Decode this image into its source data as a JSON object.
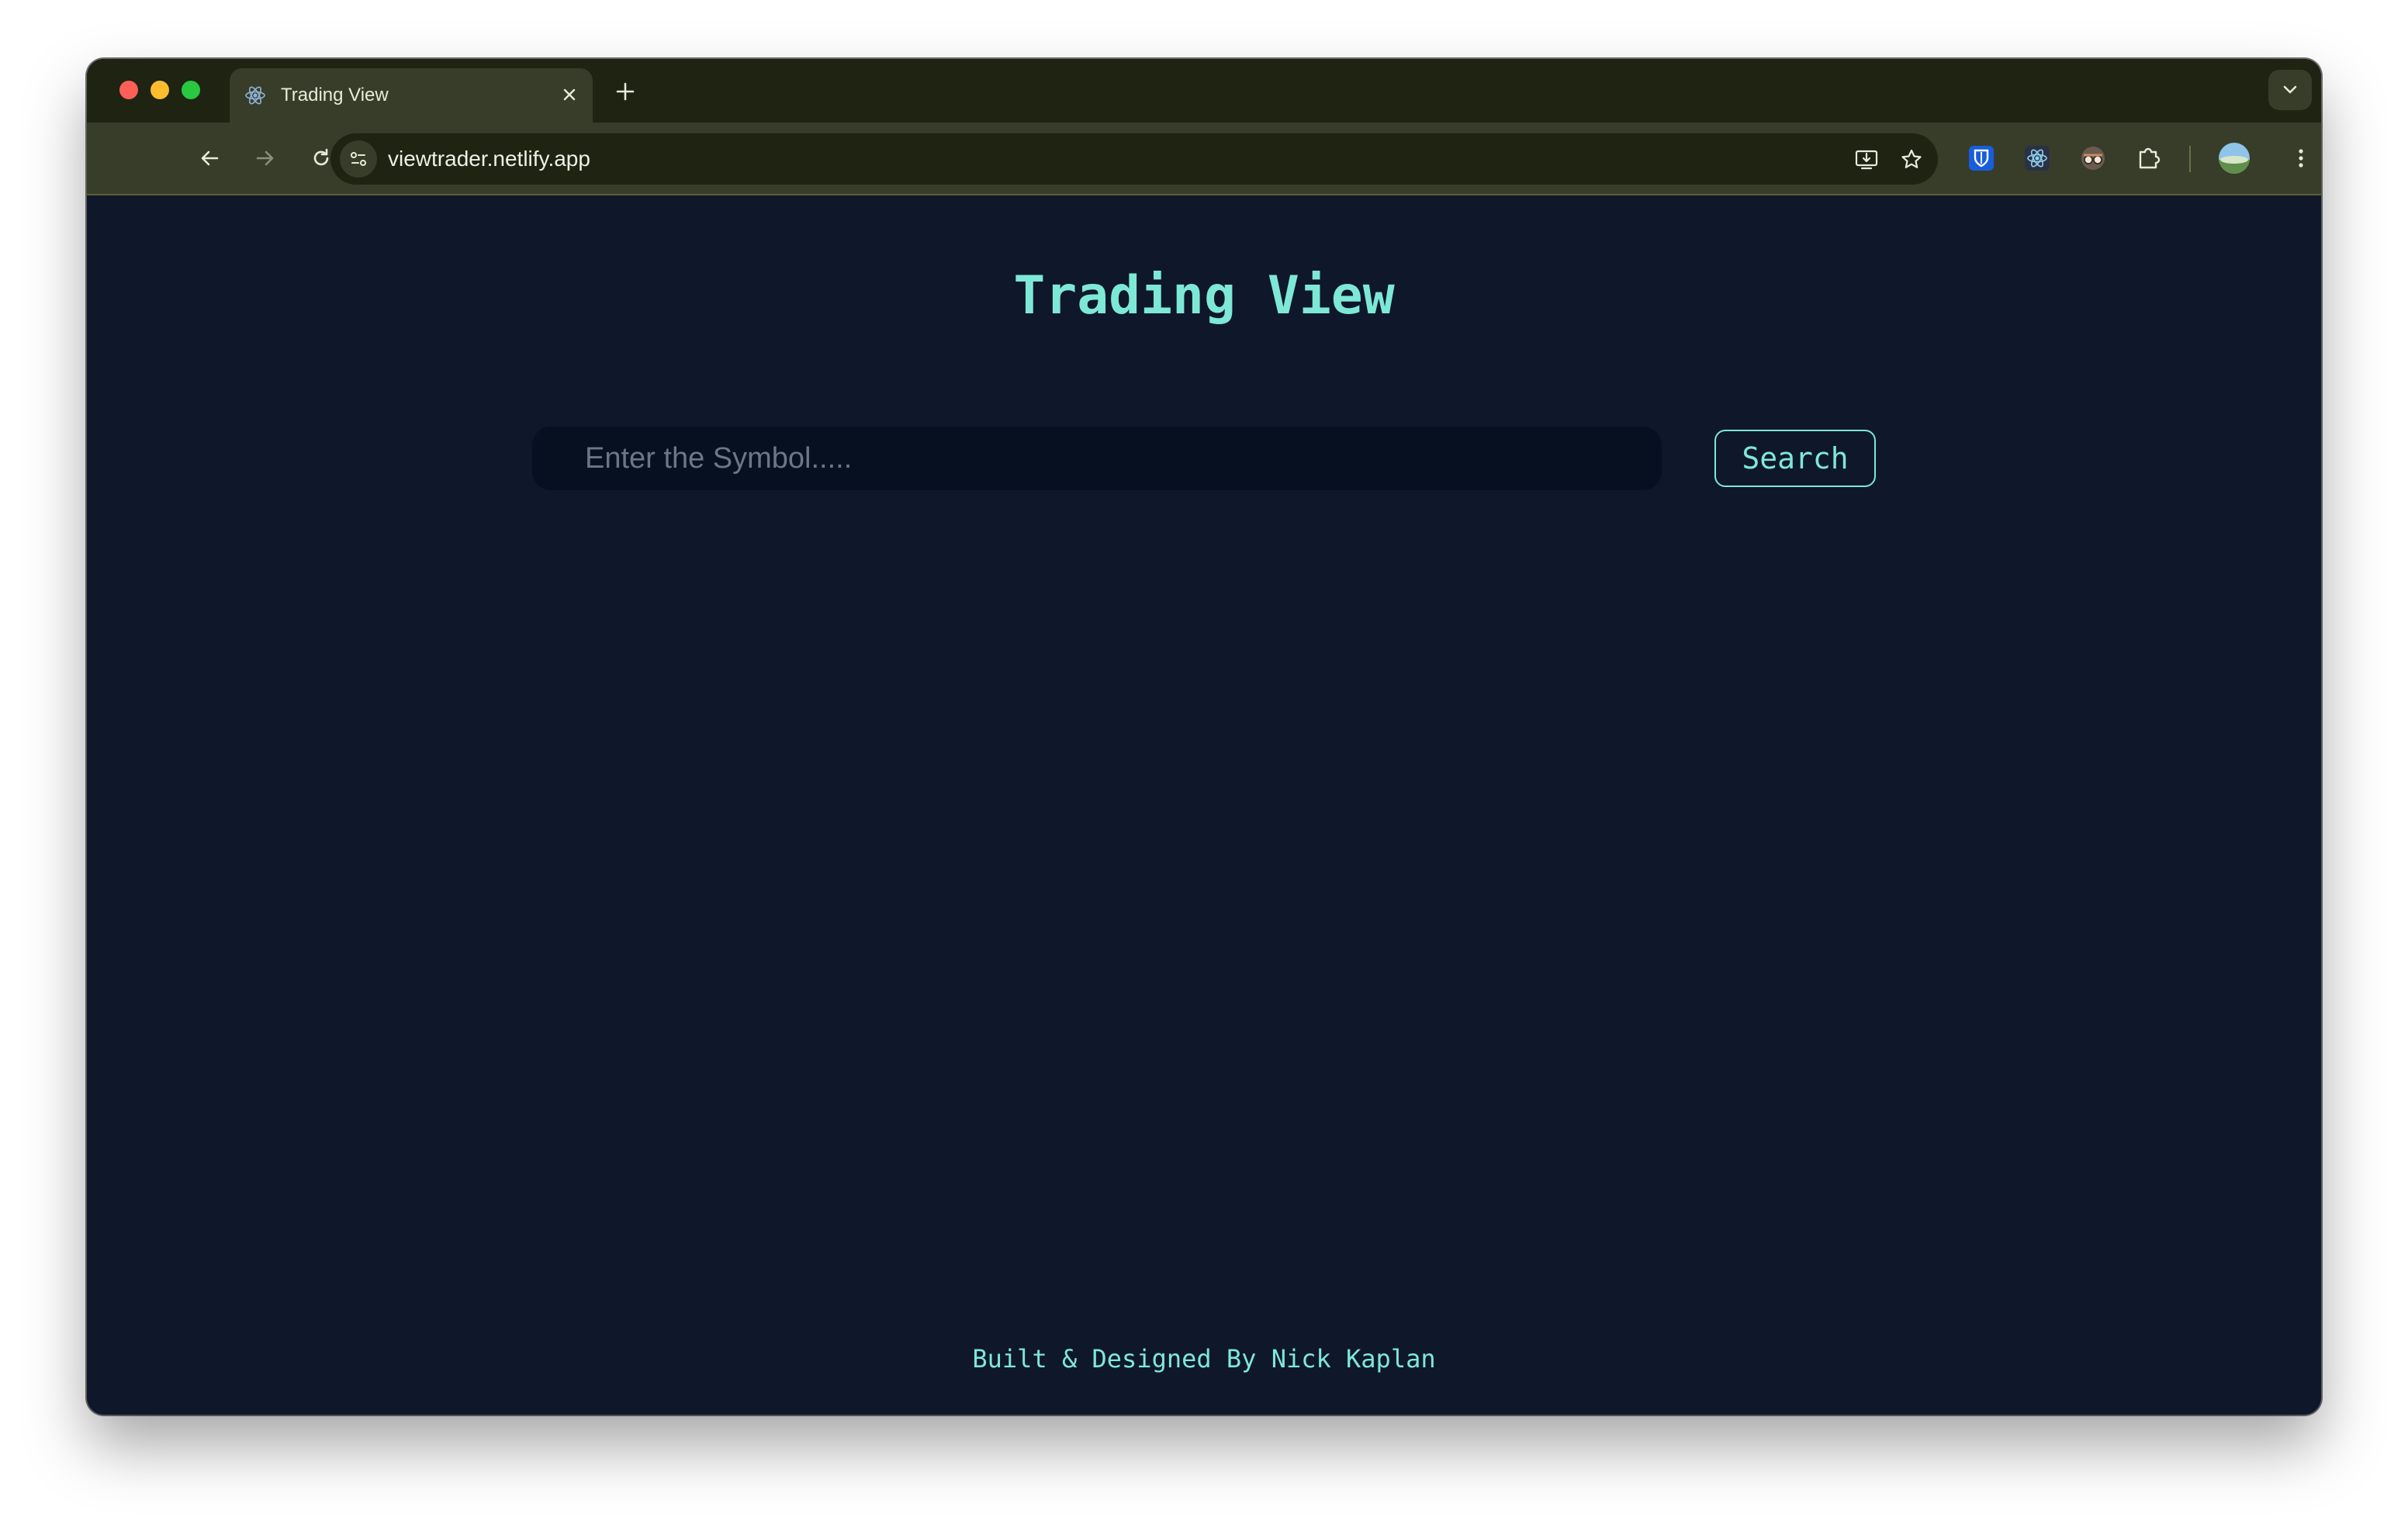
{
  "browser": {
    "tab": {
      "title": "Trading View",
      "favicon": "react-icon"
    },
    "address_bar": {
      "url": "viewtrader.netlify.app"
    },
    "toolbar_icons": [
      "back-arrow-icon",
      "forward-arrow-icon",
      "reload-icon",
      "home-icon",
      "site-info-icon",
      "install-app-icon",
      "bookmark-star-icon"
    ],
    "extensions": [
      "bitwarden-icon",
      "react-devtools-icon",
      "incognito-extension-icon",
      "extensions-puzzle-icon"
    ],
    "colors": {
      "tabstrip": "#1e2312",
      "toolbar": "#373d29"
    }
  },
  "page": {
    "title": "Trading View",
    "search": {
      "placeholder": "Enter the Symbol.....",
      "value": "",
      "button_label": "Search"
    },
    "footer": "Built & Designed By Nick Kaplan",
    "colors": {
      "background": "#0f172b",
      "accent": "#7ee8d6",
      "input_background": "#071021"
    }
  }
}
